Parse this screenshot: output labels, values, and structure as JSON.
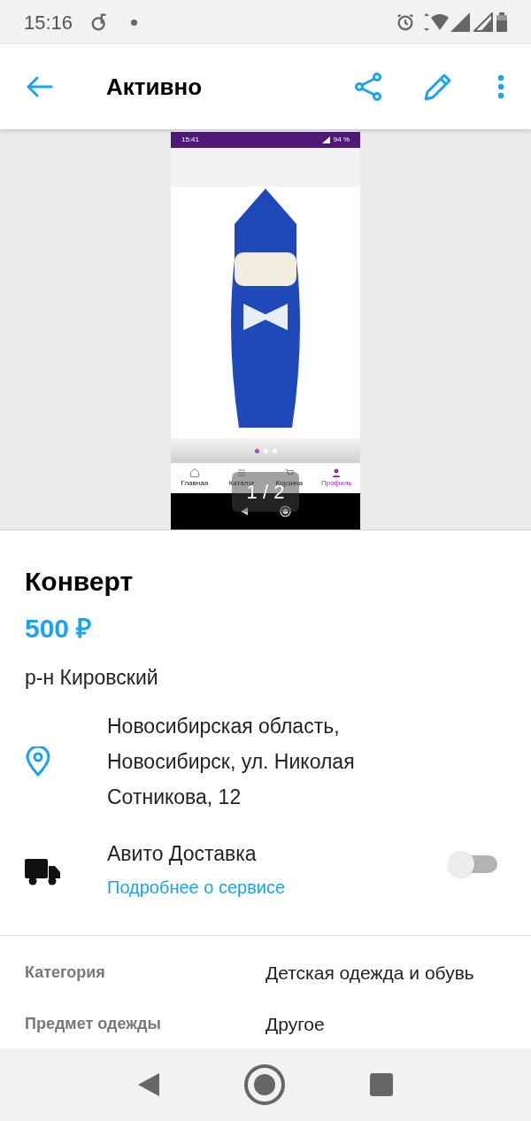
{
  "status_bar": {
    "time": "15:16"
  },
  "app_bar": {
    "title": "Активно"
  },
  "gallery": {
    "counter": "1 / 2",
    "screenshot": {
      "time": "15:41",
      "battery": "94 %",
      "dots": [
        {
          "selected": true
        },
        {
          "selected": false
        },
        {
          "selected": false
        }
      ],
      "nav": [
        {
          "label": "Главная",
          "selected": false
        },
        {
          "label": "Каталог",
          "selected": false
        },
        {
          "label": "Корзина",
          "selected": false
        },
        {
          "label": "Профиль",
          "selected": true
        }
      ]
    }
  },
  "listing": {
    "title": "Конверт",
    "price": "500 ₽",
    "district": "р-н Кировский",
    "address": "Новосибирская область, Новосибирск, ул. Николая Сотникова, 12",
    "delivery": {
      "title": "Авито Доставка",
      "link": "Подробнее о сервисе",
      "on": false
    }
  },
  "params": [
    {
      "name": "Категория",
      "value": "Детская одежда и обувь"
    },
    {
      "name": "Предмет одежды",
      "value": "Другое"
    }
  ]
}
